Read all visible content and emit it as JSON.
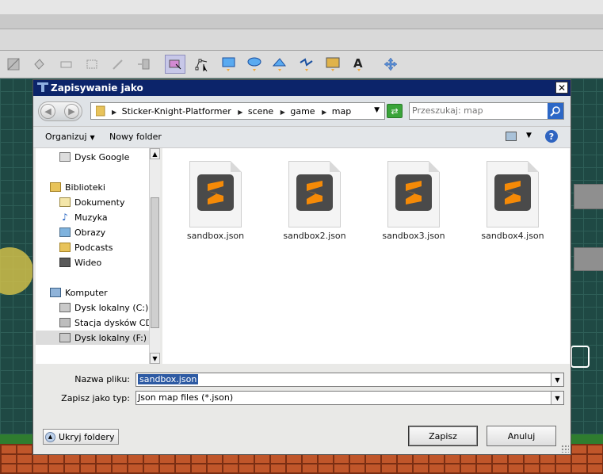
{
  "dialog": {
    "title": "Zapisywanie jako",
    "close_glyph": "✕"
  },
  "address": {
    "crumbs": [
      "Sticker-Knight-Platformer",
      "scene",
      "game",
      "map"
    ],
    "search_placeholder": "Przeszukaj: map"
  },
  "commands": {
    "organize": "Organizuj",
    "new_folder": "Nowy folder"
  },
  "nav_items": [
    {
      "label": "Dysk Google",
      "icon": "google-drive-icon"
    },
    {
      "label": "Biblioteki",
      "icon": "libraries-icon"
    },
    {
      "label": "Dokumenty",
      "icon": "documents-icon"
    },
    {
      "label": "Muzyka",
      "icon": "music-icon"
    },
    {
      "label": "Obrazy",
      "icon": "pictures-icon"
    },
    {
      "label": "Podcasts",
      "icon": "podcasts-icon"
    },
    {
      "label": "Wideo",
      "icon": "video-icon"
    },
    {
      "label": "Komputer",
      "icon": "computer-icon"
    },
    {
      "label": "Dysk lokalny (C:)",
      "icon": "local-disk-icon"
    },
    {
      "label": "Stacja dysków CD",
      "icon": "cd-drive-icon"
    },
    {
      "label": "Dysk lokalny (F:)",
      "icon": "local-disk-icon"
    }
  ],
  "files": [
    {
      "name": "sandbox.json",
      "icon": "sublime-text-icon"
    },
    {
      "name": "sandbox2.json",
      "icon": "sublime-text-icon"
    },
    {
      "name": "sandbox3.json",
      "icon": "sublime-text-icon"
    },
    {
      "name": "sandbox4.json",
      "icon": "sublime-text-icon"
    }
  ],
  "form": {
    "filename_label": "Nazwa pliku:",
    "filename_value": "sandbox.json",
    "filetype_label": "Zapisz jako typ:",
    "filetype_value": "Json map files (*.json)"
  },
  "buttons": {
    "hide_folders": "Ukryj foldery",
    "save": "Zapisz",
    "cancel": "Anuluj"
  },
  "colors": {
    "titlebar": "#0c246a",
    "sublime_orange": "#f58a07",
    "canvas_bg": "#1f4944"
  }
}
